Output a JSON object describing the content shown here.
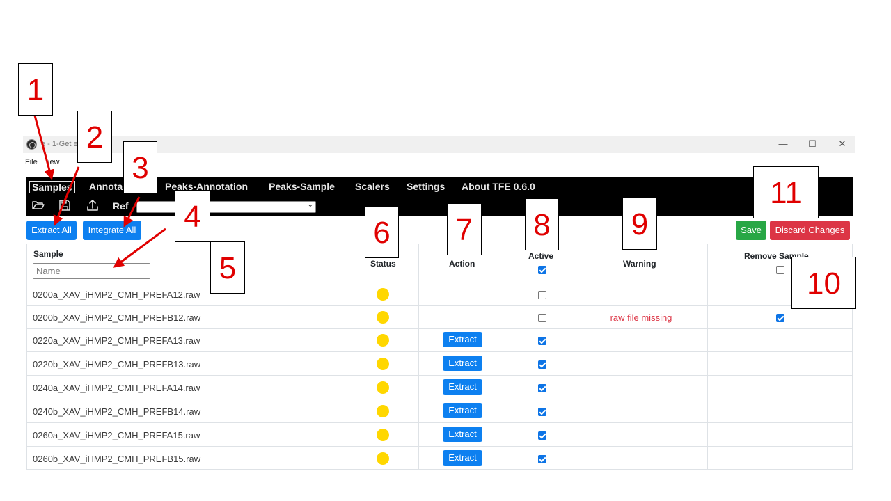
{
  "window": {
    "title": "e - 1-Get ed",
    "menu": [
      "File",
      "iew"
    ],
    "minimize_glyph": "—",
    "maximize_glyph": "☐",
    "close_glyph": "✕"
  },
  "navbar": {
    "tabs": [
      "Samples",
      "Annota",
      "Peaks-Annotation",
      "Peaks-Sample",
      "Scalers",
      "Settings",
      "About TFE 0.6.0"
    ],
    "ref_label": "Ref"
  },
  "actions": {
    "extract_all": "Extract All",
    "integrate_all": "Integrate All",
    "save": "Save",
    "discard": "Discard Changes"
  },
  "table": {
    "headers": {
      "sample": "Sample",
      "status": "Status",
      "action": "Action",
      "active": "Active",
      "warning": "Warning",
      "remove": "Remove Sample"
    },
    "name_placeholder": "Name",
    "active_all_checked": true,
    "remove_all_checked": false,
    "status_color": "#ffd700",
    "rows": [
      {
        "name": "0200a_XAV_iHMP2_CMH_PREFA12.raw",
        "action": "",
        "active": false,
        "warning": "",
        "remove": null
      },
      {
        "name": "0200b_XAV_iHMP2_CMH_PREFB12.raw",
        "action": "",
        "active": false,
        "warning": "raw file missing",
        "remove": true
      },
      {
        "name": "0220a_XAV_iHMP2_CMH_PREFA13.raw",
        "action": "Extract",
        "active": true,
        "warning": "",
        "remove": null
      },
      {
        "name": "0220b_XAV_iHMP2_CMH_PREFB13.raw",
        "action": "Extract",
        "active": true,
        "warning": "",
        "remove": null
      },
      {
        "name": "0240a_XAV_iHMP2_CMH_PREFA14.raw",
        "action": "Extract",
        "active": true,
        "warning": "",
        "remove": null
      },
      {
        "name": "0240b_XAV_iHMP2_CMH_PREFB14.raw",
        "action": "Extract",
        "active": true,
        "warning": "",
        "remove": null
      },
      {
        "name": "0260a_XAV_iHMP2_CMH_PREFA15.raw",
        "action": "Extract",
        "active": true,
        "warning": "",
        "remove": null
      },
      {
        "name": "0260b_XAV_iHMP2_CMH_PREFB15.raw",
        "action": "Extract",
        "active": true,
        "warning": "",
        "remove": null
      }
    ]
  },
  "callouts": [
    "1",
    "2",
    "3",
    "4",
    "5",
    "6",
    "7",
    "8",
    "9",
    "10",
    "11"
  ]
}
